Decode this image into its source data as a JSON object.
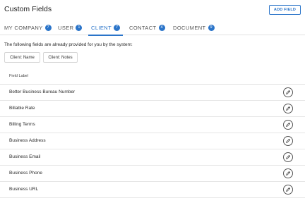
{
  "header": {
    "title": "Custom Fields",
    "add_button_label": "ADD FIELD"
  },
  "tabs": [
    {
      "label": "MY COMPANY",
      "count": "7",
      "active": false
    },
    {
      "label": "USER",
      "count": "1",
      "active": false
    },
    {
      "label": "CLIENT",
      "count": "7",
      "active": true
    },
    {
      "label": "CONTACT",
      "count": "4",
      "active": false
    },
    {
      "label": "DOCUMENT",
      "count": "9",
      "active": false
    }
  ],
  "system_fields": {
    "intro": "The following fields are already provided for you by the system:",
    "chips": [
      "Client: Name",
      "Client: Notes"
    ]
  },
  "table": {
    "column_header": "Field Label",
    "rows": [
      {
        "label": "Better Business Bureau Number",
        "icon": "pencil-icon"
      },
      {
        "label": "Billable Rate",
        "icon": "pencil-icon"
      },
      {
        "label": "Billing Terms",
        "icon": "pencil-icon"
      },
      {
        "label": "Business Address",
        "icon": "pencil-icon"
      },
      {
        "label": "Business Email",
        "icon": "pencil-icon"
      },
      {
        "label": "Business Phone",
        "icon": "pencil-icon"
      },
      {
        "label": "Business URL",
        "icon": "pencil-icon"
      }
    ]
  },
  "colors": {
    "accent": "#2a74c9"
  }
}
